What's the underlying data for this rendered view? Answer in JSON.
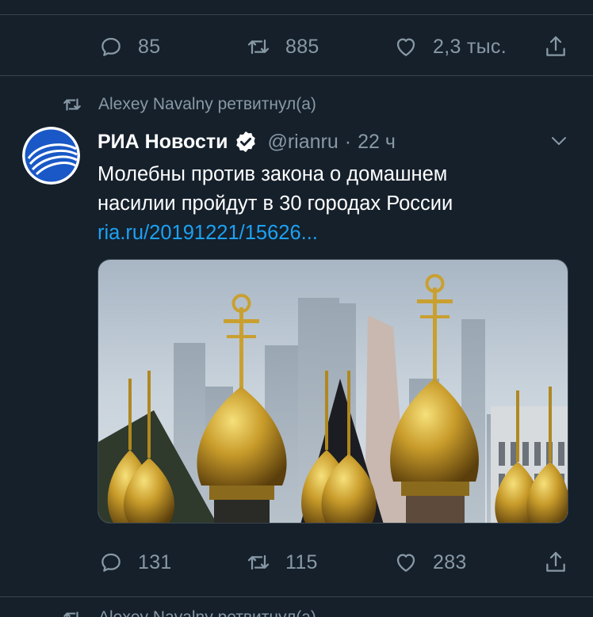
{
  "prev_tweet": {
    "reply_count": "85",
    "retweet_count": "885",
    "like_count": "2,3 тыс."
  },
  "retweet_notice": {
    "text": "Alexey Navalny ретвитнул(а)"
  },
  "tweet": {
    "author_name": "РИА Новости",
    "handle": "@rianru",
    "separator": "·",
    "time": "22 ч",
    "text_line1": "Молебны против закона о домашнем",
    "text_line2": "насилии пройдут в 30 городах России",
    "link": "ria.ru/20191221/15626...",
    "reply_count": "131",
    "retweet_count": "115",
    "like_count": "283",
    "media_description_icon": "church-domes-photo"
  },
  "next_retweet_notice": {
    "text": "Alexey Navalny ретвитнул(а)"
  },
  "colors": {
    "background": "#15202b",
    "muted": "#8899a6",
    "link": "#1da1f2",
    "separator": "#38444d"
  }
}
